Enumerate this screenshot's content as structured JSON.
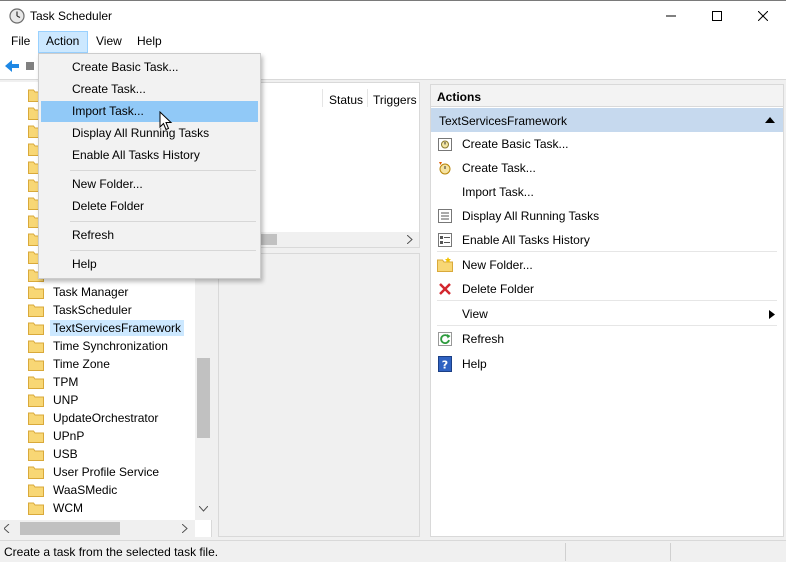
{
  "window": {
    "title": "Task Scheduler"
  },
  "menubar": {
    "items": [
      "File",
      "Action",
      "View",
      "Help"
    ],
    "active": "Action"
  },
  "action_menu": {
    "items": [
      {
        "label": "Create Basic Task..."
      },
      {
        "label": "Create Task..."
      },
      {
        "label": "Import Task...",
        "highlighted": true
      },
      {
        "label": "Display All Running Tasks"
      },
      {
        "label": "Enable All Tasks History"
      },
      {
        "label": "New Folder..."
      },
      {
        "label": "Delete Folder"
      },
      {
        "label": "Refresh"
      },
      {
        "label": "Help"
      }
    ]
  },
  "tree": {
    "items": [
      {
        "label": "Task Manager"
      },
      {
        "label": "TaskScheduler"
      },
      {
        "label": "TextServicesFramework",
        "selected": true
      },
      {
        "label": "Time Synchronization"
      },
      {
        "label": "Time Zone"
      },
      {
        "label": "TPM"
      },
      {
        "label": "UNP"
      },
      {
        "label": "UpdateOrchestrator"
      },
      {
        "label": "UPnP"
      },
      {
        "label": "USB"
      },
      {
        "label": "User Profile Service"
      },
      {
        "label": "WaaSMedic"
      },
      {
        "label": "WCM"
      }
    ]
  },
  "task_list": {
    "columns": [
      "Status",
      "Triggers"
    ]
  },
  "actions_pane": {
    "header": "Actions",
    "group": "TextServicesFramework",
    "items": [
      {
        "label": "Create Basic Task...",
        "icon": "create-basic-task-icon"
      },
      {
        "label": "Create Task...",
        "icon": "create-task-icon"
      },
      {
        "label": "Import Task...",
        "icon": ""
      },
      {
        "label": "Display All Running Tasks",
        "icon": "running-tasks-icon"
      },
      {
        "label": "Enable All Tasks History",
        "icon": "history-icon"
      },
      {
        "label": "New Folder...",
        "icon": "new-folder-icon"
      },
      {
        "label": "Delete Folder",
        "icon": "delete-icon"
      },
      {
        "label": "View",
        "icon": "",
        "submenu": true
      },
      {
        "label": "Refresh",
        "icon": "refresh-icon"
      },
      {
        "label": "Help",
        "icon": "help-icon"
      }
    ]
  },
  "statusbar": {
    "text": "Create a task from the selected task file."
  }
}
